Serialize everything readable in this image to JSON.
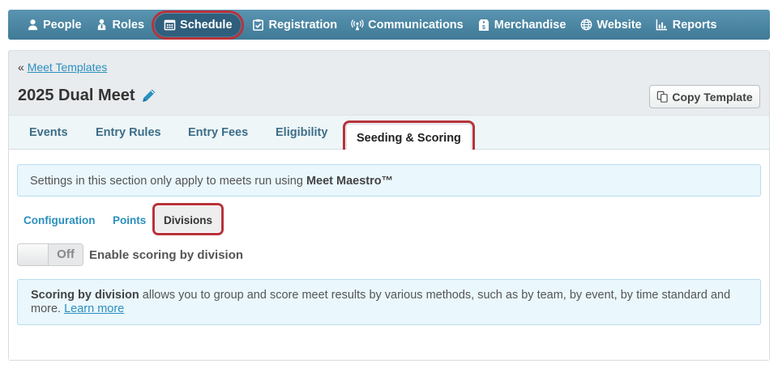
{
  "nav": {
    "items": [
      {
        "label": "People",
        "icon": "person-icon"
      },
      {
        "label": "Roles",
        "icon": "roles-icon"
      },
      {
        "label": "Schedule",
        "icon": "calendar-icon",
        "active": true
      },
      {
        "label": "Registration",
        "icon": "clipboard-check-icon"
      },
      {
        "label": "Communications",
        "icon": "broadcast-icon"
      },
      {
        "label": "Merchandise",
        "icon": "tag-icon"
      },
      {
        "label": "Website",
        "icon": "globe-icon"
      },
      {
        "label": "Reports",
        "icon": "bar-chart-icon"
      }
    ]
  },
  "breadcrumb": {
    "prefix": "«",
    "link": "Meet Templates"
  },
  "page": {
    "title": "2025 Dual Meet",
    "copy_button": "Copy Template"
  },
  "tabs": [
    {
      "label": "Events"
    },
    {
      "label": "Entry Rules"
    },
    {
      "label": "Entry Fees"
    },
    {
      "label": "Eligibility"
    },
    {
      "label": "Seeding & Scoring",
      "active": true
    }
  ],
  "info_note": {
    "text": "Settings in this section only apply to meets run using ",
    "bold": "Meet Maestro™"
  },
  "subtabs": [
    {
      "label": "Configuration"
    },
    {
      "label": "Points"
    },
    {
      "label": "Divisions",
      "active": true
    }
  ],
  "toggle": {
    "state": "Off",
    "label": "Enable scoring by division"
  },
  "description": {
    "bold": "Scoring by division",
    "text": " allows you to group and score meet results by various methods, such as by team, by event, by time standard and more. ",
    "link": "Learn more"
  },
  "colors": {
    "nav_bg": "#4a87a4",
    "active_pill": "#2f5f7c",
    "highlight_outline": "#b8323a",
    "link": "#2a8fbf",
    "tab_text": "#3d6d87",
    "note_bg": "#eaf7fd"
  }
}
